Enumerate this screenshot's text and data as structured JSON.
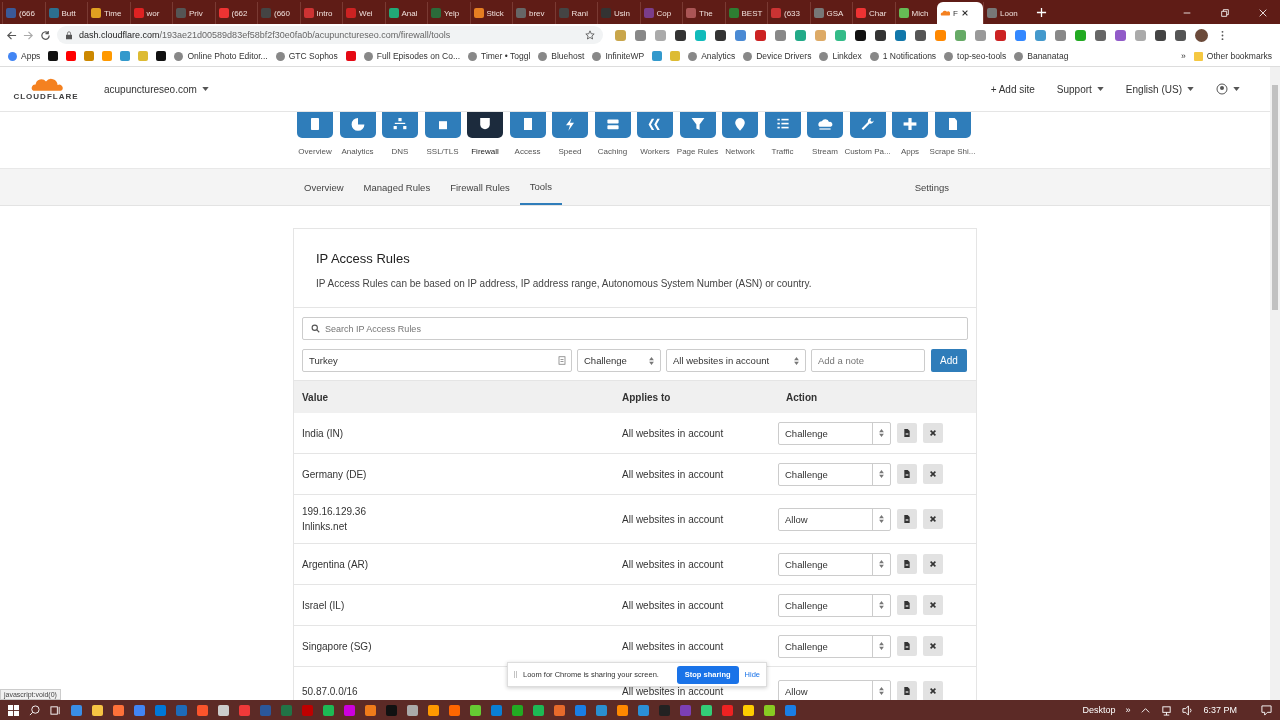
{
  "browser": {
    "tabs": [
      {
        "title": "(666",
        "selected": false
      },
      {
        "title": "Butt",
        "selected": false
      },
      {
        "title": "Time",
        "selected": false
      },
      {
        "title": "wor",
        "selected": false
      },
      {
        "title": "Priv",
        "selected": false
      },
      {
        "title": "(662",
        "selected": false
      },
      {
        "title": "(660",
        "selected": false
      },
      {
        "title": "Intro",
        "selected": false
      },
      {
        "title": "Wei",
        "selected": false
      },
      {
        "title": "Anal",
        "selected": false
      },
      {
        "title": "Yelp",
        "selected": false
      },
      {
        "title": "Stick",
        "selected": false
      },
      {
        "title": "brev",
        "selected": false
      },
      {
        "title": "Rani",
        "selected": false
      },
      {
        "title": "Usin",
        "selected": false
      },
      {
        "title": "Cop",
        "selected": false
      },
      {
        "title": "The",
        "selected": false
      },
      {
        "title": "BEST",
        "selected": false
      },
      {
        "title": "(633",
        "selected": false
      },
      {
        "title": "GSA",
        "selected": false
      },
      {
        "title": "Char",
        "selected": false
      },
      {
        "title": "Mich",
        "selected": false
      },
      {
        "title": "F",
        "selected": true
      },
      {
        "title": "Loon",
        "selected": false
      }
    ],
    "address_bar": {
      "url_host": "dash.cloudflare.com",
      "url_path": "/193ae21d00589d83ef58bf2f30e0fa0b/acupunctureseo.com/firewall/tools"
    },
    "bookmarks": [
      {
        "kind": "link",
        "label": "Apps"
      },
      {
        "kind": "icon"
      },
      {
        "kind": "icon"
      },
      {
        "kind": "icon"
      },
      {
        "kind": "icon"
      },
      {
        "kind": "icon"
      },
      {
        "kind": "icon"
      },
      {
        "kind": "icon"
      },
      {
        "kind": "link",
        "label": "Online Photo Editor..."
      },
      {
        "kind": "link",
        "label": "GTC Sophos"
      },
      {
        "kind": "icon"
      },
      {
        "kind": "link",
        "label": "Full Episodes on Co..."
      },
      {
        "kind": "link",
        "label": "Timer • Toggl"
      },
      {
        "kind": "link",
        "label": "Bluehost"
      },
      {
        "kind": "link",
        "label": "InfiniteWP"
      },
      {
        "kind": "icon"
      },
      {
        "kind": "icon"
      },
      {
        "kind": "link",
        "label": "Analytics"
      },
      {
        "kind": "link",
        "label": "Device Drivers"
      },
      {
        "kind": "link",
        "label": "Linkdex"
      },
      {
        "kind": "link",
        "label": "1 Notifications"
      },
      {
        "kind": "link",
        "label": "top-seo-tools"
      },
      {
        "kind": "link",
        "label": "Bananatag"
      }
    ],
    "bookmarks_more": "»",
    "other_bookmarks": "Other bookmarks"
  },
  "header": {
    "logo": "CLOUDFLARE",
    "domain": "acupunctureseo.com",
    "add_site": "+ Add site",
    "support": "Support",
    "language": "English (US)"
  },
  "nav": [
    {
      "label": "Overview",
      "selected": false
    },
    {
      "label": "Analytics",
      "selected": false
    },
    {
      "label": "DNS",
      "selected": false
    },
    {
      "label": "SSL/TLS",
      "selected": false
    },
    {
      "label": "Firewall",
      "selected": true
    },
    {
      "label": "Access",
      "selected": false
    },
    {
      "label": "Speed",
      "selected": false
    },
    {
      "label": "Caching",
      "selected": false
    },
    {
      "label": "Workers",
      "selected": false
    },
    {
      "label": "Page Rules",
      "selected": false
    },
    {
      "label": "Network",
      "selected": false
    },
    {
      "label": "Traffic",
      "selected": false
    },
    {
      "label": "Stream",
      "selected": false
    },
    {
      "label": "Custom Pa...",
      "selected": false
    },
    {
      "label": "Apps",
      "selected": false
    },
    {
      "label": "Scrape Shi...",
      "selected": false
    }
  ],
  "subnav": [
    {
      "label": "Overview",
      "selected": false
    },
    {
      "label": "Managed Rules",
      "selected": false
    },
    {
      "label": "Firewall Rules",
      "selected": false
    },
    {
      "label": "Tools",
      "selected": true
    }
  ],
  "settings_link": "Settings",
  "card": {
    "title": "IP Access Rules",
    "description": "IP Access Rules can be based on IP address, IP address range, Autonomous System Number (ASN) or country.",
    "search": {
      "placeholder": "Search IP Access Rules"
    },
    "form": {
      "value": "Turkey",
      "action": "Challenge",
      "applies_to": "All websites in account",
      "note": {
        "placeholder": "Add a note"
      },
      "button": "Add"
    }
  },
  "table": {
    "columns": [
      "Value",
      "Applies to",
      "Action"
    ],
    "rows": [
      {
        "value": "India (IN)",
        "applies_to": "All websites in account",
        "action": "Challenge"
      },
      {
        "value": "Germany (DE)",
        "applies_to": "All websites in account",
        "action": "Challenge"
      },
      {
        "value": "199.16.129.36",
        "note": "Inlinks.net",
        "applies_to": "All websites in account",
        "action": "Allow"
      },
      {
        "value": "Argentina (AR)",
        "applies_to": "All websites in account",
        "action": "Challenge"
      },
      {
        "value": "Israel (IL)",
        "applies_to": "All websites in account",
        "action": "Challenge"
      },
      {
        "value": "Singapore (SG)",
        "applies_to": "All websites in account",
        "action": "Challenge"
      },
      {
        "value": "50.87.0.0/16",
        "applies_to": "All websites in account",
        "action": "Allow"
      }
    ]
  },
  "loom_banner": {
    "message": "Loom for Chrome is sharing your screen.",
    "stop_button": "Stop sharing",
    "hide_link": "Hide"
  },
  "status_tooltip": "javascript:void(0)",
  "taskbar": {
    "desktop_label": "Desktop",
    "more": "»",
    "time": "6:37 PM"
  }
}
